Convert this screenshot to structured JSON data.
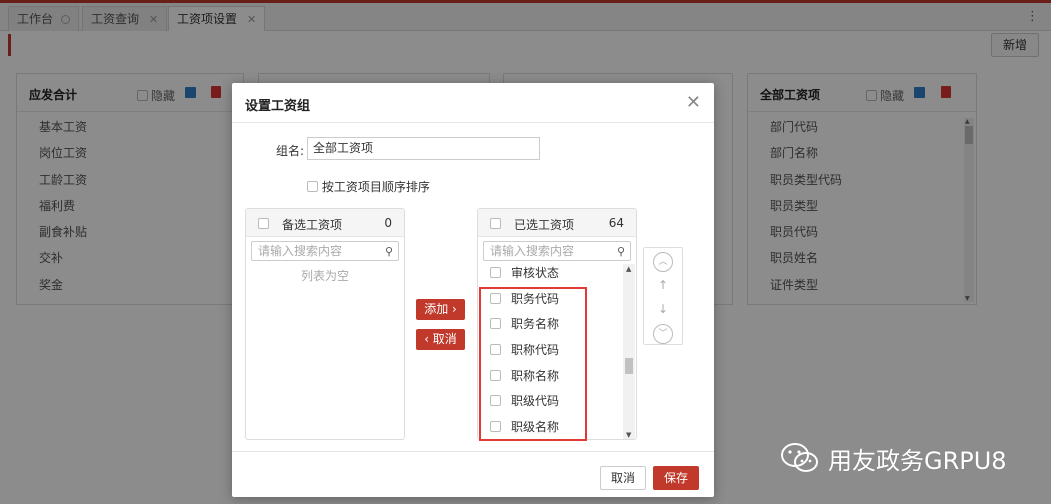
{
  "tabs": [
    {
      "label": "工作台"
    },
    {
      "label": "工资查询"
    },
    {
      "label": "工资项设置"
    }
  ],
  "toolbar": {
    "new_label": "新增"
  },
  "panels": {
    "left": {
      "title": "应发合计",
      "hide_label": "隐藏",
      "items": [
        "基本工资",
        "岗位工资",
        "工龄工资",
        "福利费",
        "副食补贴",
        "交补",
        "奖金"
      ]
    },
    "right": {
      "title": "全部工资项",
      "hide_label": "隐藏",
      "items": [
        "部门代码",
        "部门名称",
        "职员类型代码",
        "职员类型",
        "职员代码",
        "职员姓名",
        "证件类型"
      ]
    }
  },
  "modal": {
    "title": "设置工资组",
    "group_label": "组名:",
    "group_value": "全部工资项",
    "sort_label": "按工资项目顺序排序",
    "available": {
      "title": "备选工资项",
      "count": "0",
      "search_placeholder": "请输入搜索内容",
      "empty_text": "列表为空"
    },
    "selected": {
      "title": "已选工资项",
      "count": "64",
      "search_placeholder": "请输入搜索内容",
      "items": [
        "审核状态",
        "职务代码",
        "职务名称",
        "职称代码",
        "职称名称",
        "职级代码",
        "职级名称"
      ]
    },
    "add_label": "添加 ›",
    "remove_label": "‹ 取消",
    "cancel_label": "取消",
    "save_label": "保存"
  },
  "watermark": {
    "text": "用友政务GRPU8"
  },
  "colors": {
    "accent": "#c0392b",
    "highlight_box": "#e53935"
  }
}
